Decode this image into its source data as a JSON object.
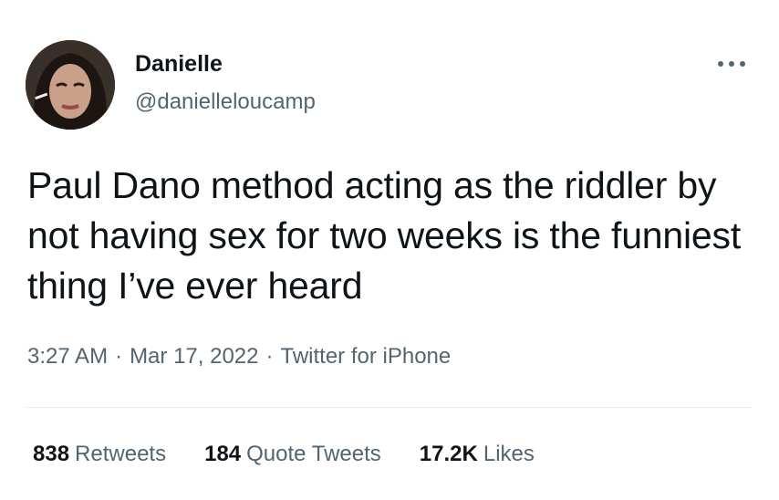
{
  "tweet": {
    "author": {
      "display_name": "Danielle",
      "handle": "@danielleloucamp",
      "avatar": "profile-photo"
    },
    "more_icon": "more-horizontal-icon",
    "text": "Paul Dano method acting as the riddler by not having sex for two weeks is the funniest thing I’ve ever heard",
    "meta": {
      "time": "3:27 AM",
      "separator": "·",
      "date": "Mar 17, 2022",
      "source": "Twitter for iPhone"
    },
    "stats": {
      "retweets": {
        "count": "838",
        "label": "Retweets"
      },
      "quote_tweets": {
        "count": "184",
        "label": "Quote Tweets"
      },
      "likes": {
        "count": "17.2K",
        "label": "Likes"
      }
    }
  },
  "colors": {
    "primary_text": "#0f1419",
    "secondary_text": "#536471",
    "divider": "#e6ecf0"
  }
}
